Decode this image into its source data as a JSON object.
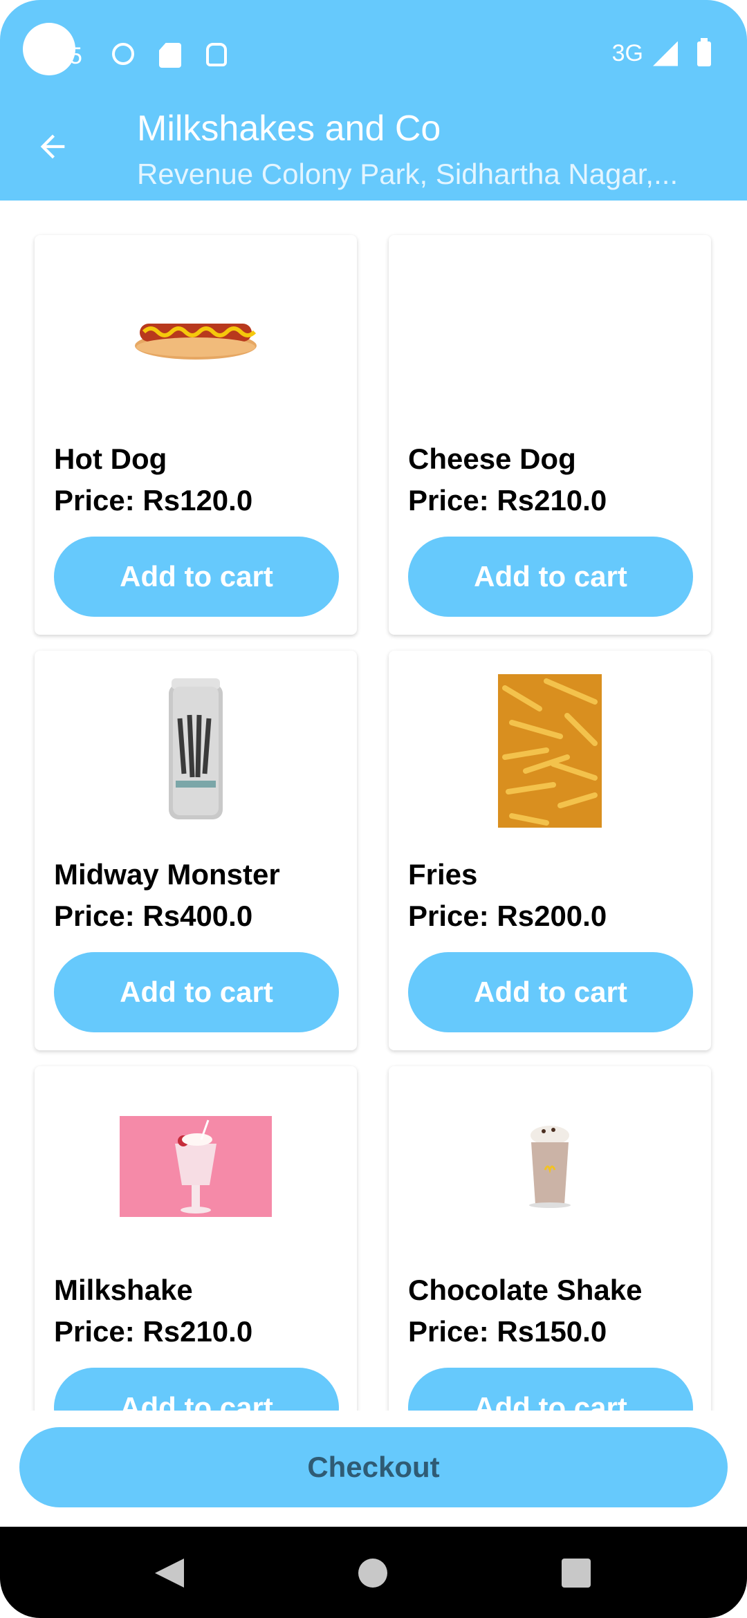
{
  "status_bar": {
    "time_partial": "5",
    "network": "3G"
  },
  "header": {
    "title": "Milkshakes and Co",
    "subtitle": "Revenue Colony Park, Sidhartha Nagar,..."
  },
  "products": [
    {
      "name": "Hot Dog",
      "price": "Price: Rs120.0",
      "button": "Add to cart",
      "image": "hot-dog-image"
    },
    {
      "name": "Cheese Dog",
      "price": "Price: Rs210.0",
      "button": "Add to cart",
      "image": "none"
    },
    {
      "name": "Midway Monster",
      "price": "Price: Rs400.0",
      "button": "Add to cart",
      "image": "energy-drink-can-image"
    },
    {
      "name": "Fries",
      "price": "Price: Rs200.0",
      "button": "Add to cart",
      "image": "fries-image"
    },
    {
      "name": "Milkshake",
      "price": "Price: Rs210.0",
      "button": "Add to cart",
      "image": "milkshake-image"
    },
    {
      "name": "Chocolate Shake",
      "price": "Price: Rs150.0",
      "button": "Add to cart",
      "image": "chocolate-shake-image"
    }
  ],
  "checkout": {
    "label": "Checkout"
  },
  "colors": {
    "accent": "#66c9fc",
    "checkout_text": "#2f5b74"
  }
}
